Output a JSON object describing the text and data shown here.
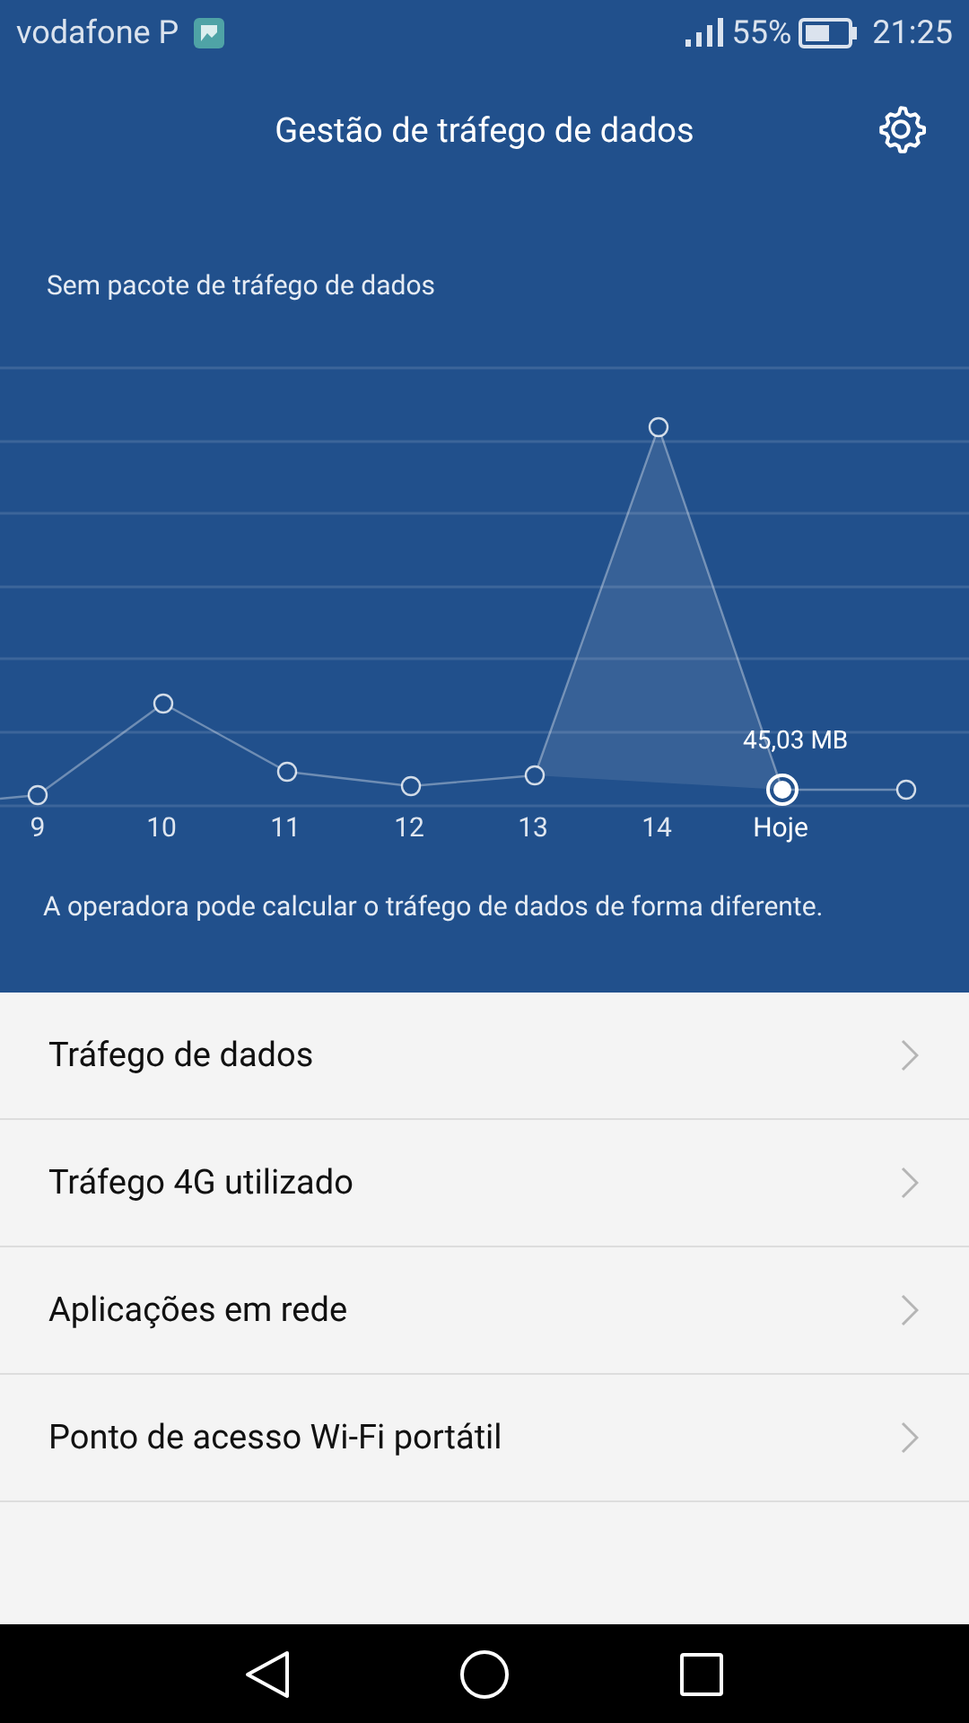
{
  "status_bar": {
    "carrier": "vodafone P",
    "battery": "55%",
    "time": "21:25"
  },
  "header": {
    "title": "Gestão de tráfego de dados"
  },
  "plan": "Sem pacote de tráfego de dados",
  "chart": {
    "reading": "45,03 MB",
    "days": [
      {
        "label": "9",
        "selected": false
      },
      {
        "label": "10",
        "selected": false
      },
      {
        "label": "11",
        "selected": false
      },
      {
        "label": "12",
        "selected": false
      },
      {
        "label": "13",
        "selected": false
      },
      {
        "label": "14",
        "selected": false
      },
      {
        "label": "Hoje",
        "selected": true
      }
    ]
  },
  "note": "A operadora pode calcular o tráfego de dados de forma diferente.",
  "menu": [
    {
      "label": "Tráfego de dados"
    },
    {
      "label": "Tráfego 4G utilizado"
    },
    {
      "label": "Aplicações em rede"
    },
    {
      "label": "Ponto de acesso Wi-Fi portátil"
    }
  ]
}
